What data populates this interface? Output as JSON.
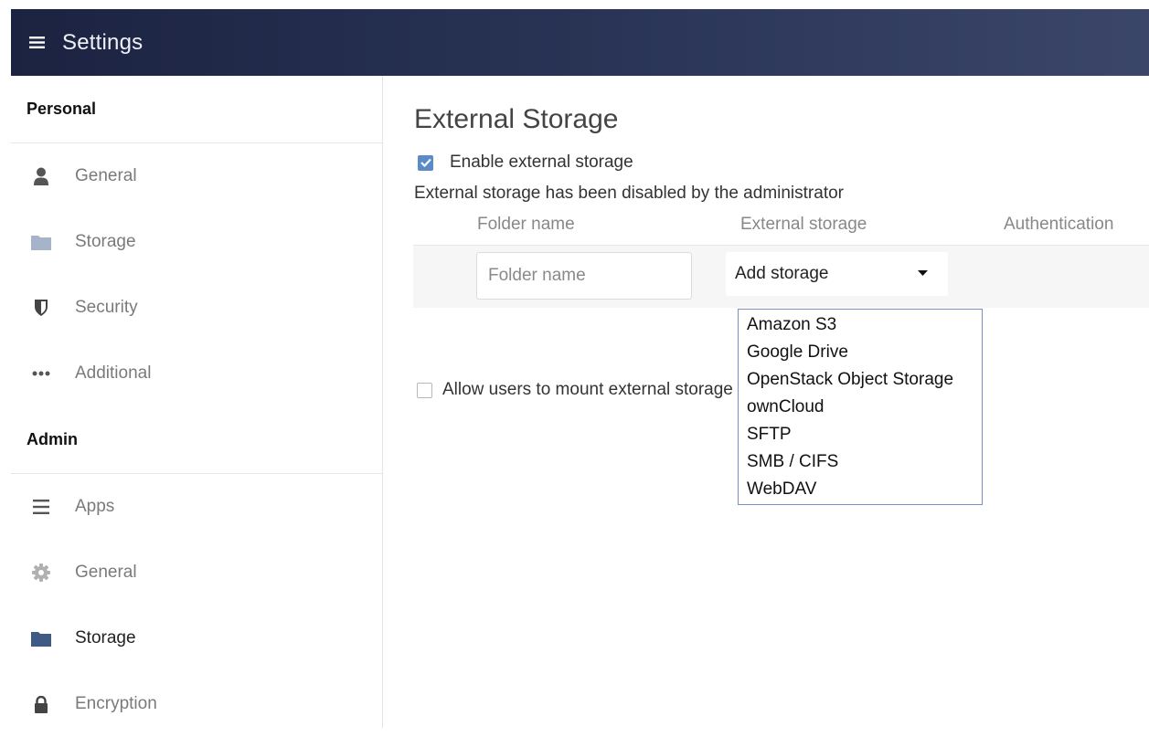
{
  "header": {
    "title": "Settings",
    "menu_icon": "hamburger-menu-icon"
  },
  "sidebar": {
    "sections": [
      {
        "title": "Personal",
        "items": [
          {
            "label": "General",
            "icon": "person-icon",
            "active": false
          },
          {
            "label": "Storage",
            "icon": "folder-icon",
            "active": false
          },
          {
            "label": "Security",
            "icon": "shield-icon",
            "active": false
          },
          {
            "label": "Additional",
            "icon": "more-dots-icon",
            "active": false
          }
        ]
      },
      {
        "title": "Admin",
        "items": [
          {
            "label": "Apps",
            "icon": "apps-list-icon",
            "active": false
          },
          {
            "label": "General",
            "icon": "gear-icon",
            "active": false
          },
          {
            "label": "Storage",
            "icon": "folder-icon",
            "active": true
          },
          {
            "label": "Encryption",
            "icon": "lock-icon",
            "active": false
          }
        ]
      }
    ]
  },
  "main": {
    "title": "External Storage",
    "enable_checkbox": {
      "label": "Enable external storage",
      "checked": true
    },
    "notice": "External storage has been disabled by the administrator",
    "columns": [
      "Folder name",
      "External storage",
      "Authentication"
    ],
    "row": {
      "folder_placeholder": "Folder name",
      "storage_select_value": "Add storage"
    },
    "storage_options": [
      "Amazon S3",
      "Google Drive",
      "OpenStack Object Storage",
      "ownCloud",
      "SFTP",
      "SMB / CIFS",
      "WebDAV"
    ],
    "allow_checkbox": {
      "label": "Allow users to mount external storage",
      "checked": false
    }
  },
  "colors": {
    "header_bg_start": "#1c2341",
    "header_bg_end": "#3b4668",
    "accent": "#5a8ac7",
    "active_folder_icon": "#3f5a85",
    "inactive_folder_icon": "#a6b4c9",
    "dropdown_border": "#7a8fc8"
  }
}
